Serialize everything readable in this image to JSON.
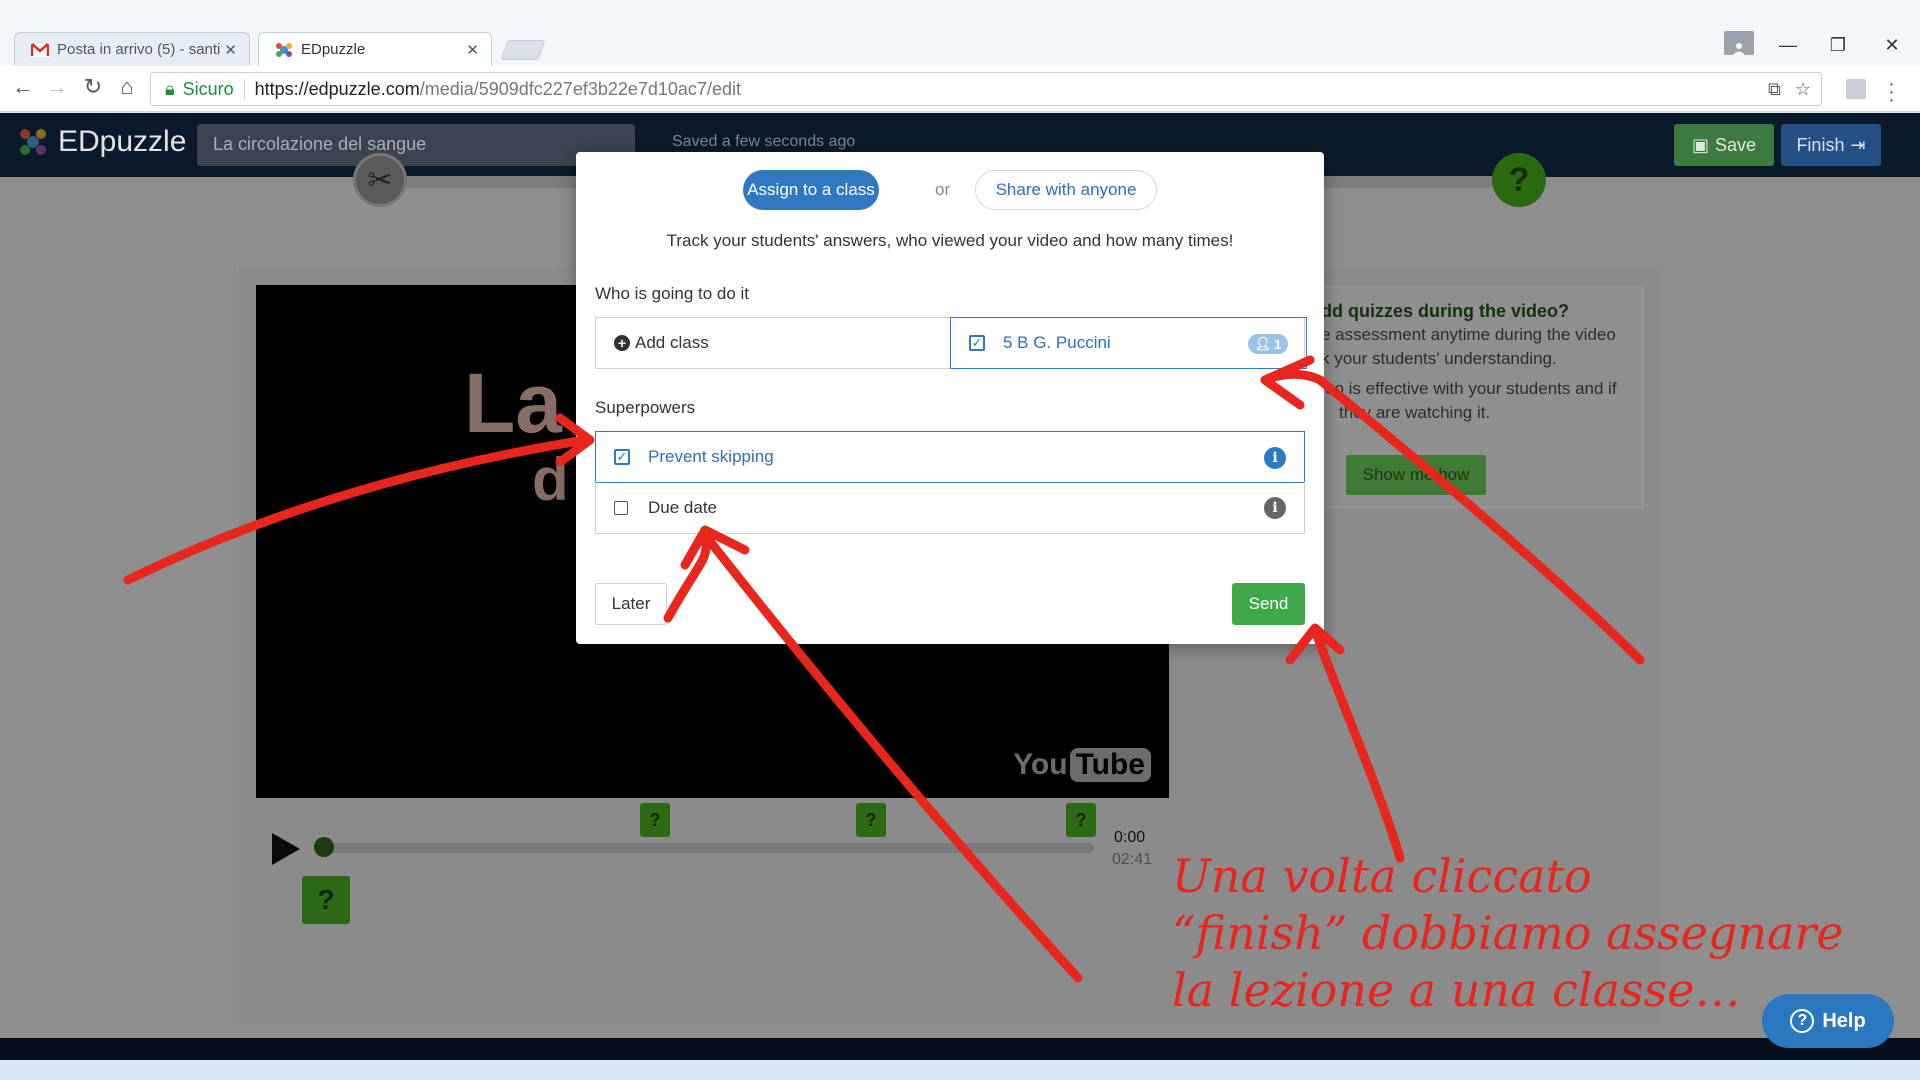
{
  "browser": {
    "tabs": [
      {
        "title": "Posta in arrivo (5) - santi",
        "icon": "gmail-icon"
      },
      {
        "title": "EDpuzzle",
        "icon": "edpuzzle-icon"
      }
    ],
    "secure_label": "Sicuro",
    "url_domain": "https://edpuzzle.com",
    "url_path": "/media/5909dfc227ef3b22e7d10ac7/edit"
  },
  "app": {
    "logo": "EDpuzzle",
    "lesson_title": "La circolazione del sangue",
    "saved_status": "Saved a few seconds ago",
    "save_label": "Save",
    "finish_label": "Finish",
    "video": {
      "overlay_text_1": "La c",
      "overlay_text_2": "d",
      "youtube_label_1": "You",
      "youtube_label_2": "Tube",
      "current_time": "0:00",
      "duration": "02:41",
      "quiz_marker": "?"
    },
    "side_card": {
      "heading": "dd quizzes during the video?",
      "line1": "e assessment anytime during the video",
      "line2": "k your students' understanding.",
      "line3": "eo is effective with your students and if",
      "line4": "they are watching it.",
      "button": "Show me how"
    }
  },
  "modal": {
    "assign_label": "Assign to a class",
    "or_label": "or",
    "share_label": "Share with anyone",
    "description": "Track your students' answers, who viewed your video and how many times!",
    "who_label": "Who is going to do it",
    "add_class_label": "Add class",
    "selected_class": "5 B G. Puccini",
    "class_student_count": "1",
    "superpowers_label": "Superpowers",
    "prevent_skipping": {
      "label": "Prevent skipping",
      "checked": true
    },
    "due_date": {
      "label": "Due date",
      "checked": false
    },
    "later_label": "Later",
    "send_label": "Send"
  },
  "annotation": {
    "line1": "Una volta cliccato",
    "line2": "“finish” dobbiamo assegnare",
    "line3": "la lezione a una classe…",
    "color": "#e8261d"
  },
  "help_label": "Help",
  "colors": {
    "primary_blue": "#2f78c2",
    "send_green": "#3fa84a",
    "app_dark": "#0a1a2b"
  }
}
